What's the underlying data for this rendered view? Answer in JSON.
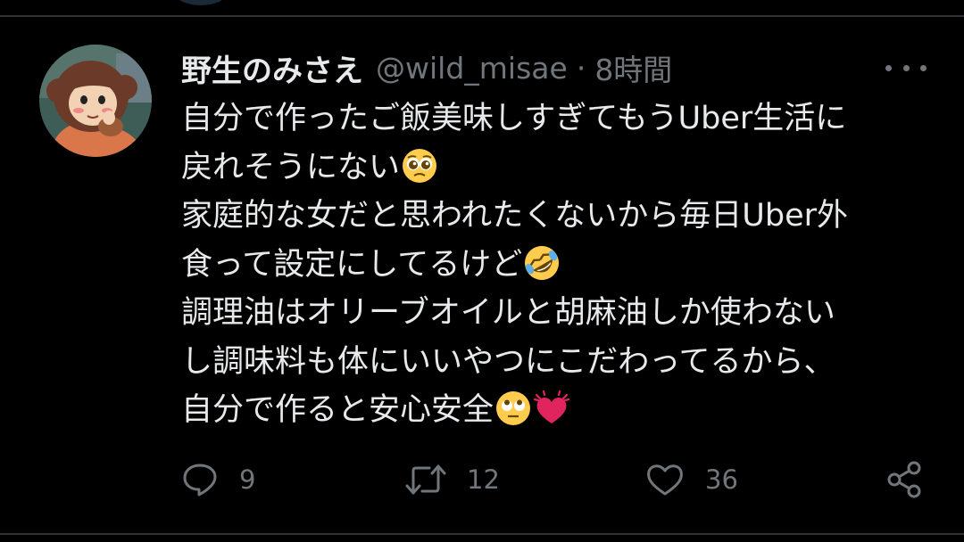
{
  "tweet": {
    "display_name": "野生のみさえ",
    "handle": "@wild_misae",
    "separator": "·",
    "time": "8時間",
    "lines": [
      "自分で作ったご飯美味しすぎてもうUber生活に",
      "戻れそうにない",
      "家庭的な女だと思われたくないから毎日Uber外",
      "食って設定にしてるけど",
      "調理油はオリーブオイルと胡麻油しか使わない",
      "し調味料も体にいいやつにこだわってるから、",
      "自分で作ると安心安全"
    ],
    "emojis": {
      "line2": "pleading-face-emoji",
      "line4": "rolling-on-floor-laughing-emoji",
      "line7": [
        "face-with-rolling-eyes-emoji",
        "beating-heart-emoji"
      ]
    }
  },
  "actions": {
    "reply_count": "9",
    "retweet_count": "12",
    "like_count": "36"
  },
  "colors": {
    "background": "#000000",
    "text_primary": "#e7e9ea",
    "text_secondary": "#71767b",
    "divider": "#2f3336",
    "heart_emoji": "#e0245e"
  }
}
